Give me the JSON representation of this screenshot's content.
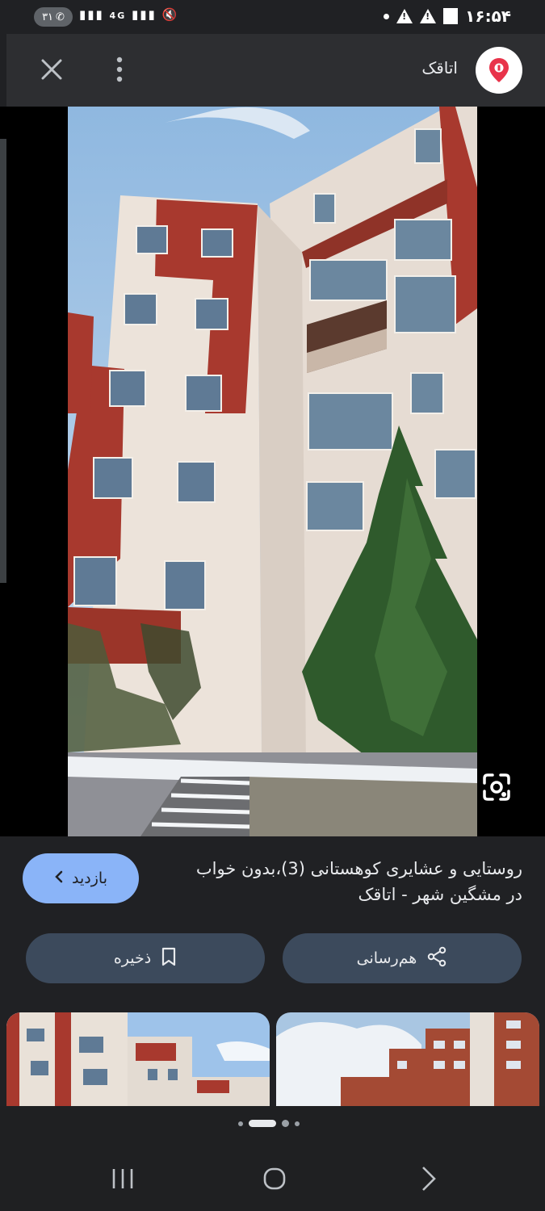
{
  "status_bar": {
    "time": "۱۶:۵۴",
    "pill_text": "۳۱",
    "signal_label": "4G"
  },
  "top_bar": {
    "site_name": "اتاقک",
    "close_icon": "close-icon",
    "more_icon": "more-vert-icon",
    "logo_icon": "map-pin-icon",
    "brand_color": "#e8334a"
  },
  "main_image": {
    "lens_icon": "google-lens-icon"
  },
  "info": {
    "title": "روستایی و عشایری کوهستانی (3)،بدون خواب در مشگین شهر - اتاقک",
    "visit_label": "بازدید",
    "share_label": "هم‌رسانی",
    "save_label": "ذخیره"
  },
  "pager": {
    "count": 5,
    "active_index": 1
  },
  "nav": {
    "recents_icon": "recents-icon",
    "home_icon": "home-icon",
    "back_icon": "back-icon"
  }
}
